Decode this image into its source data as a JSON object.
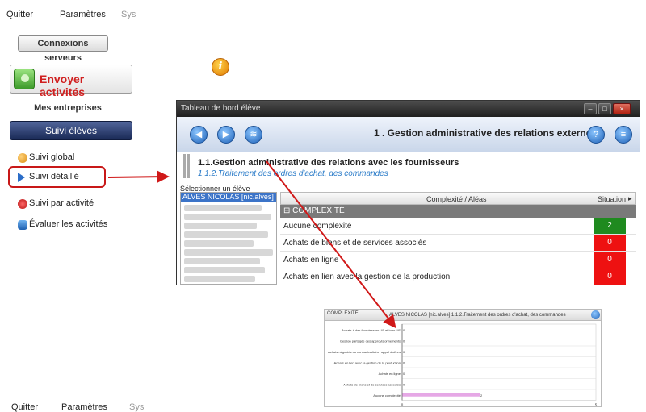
{
  "menubar": {
    "quit": "Quitter",
    "settings": "Paramètres",
    "sys": "Sys"
  },
  "left_panel": {
    "connexions_button": "Connexions serveurs",
    "send_button": "Envoyer activités",
    "companies_label": "Mes entreprises",
    "suivi_header": "Suivi élèves",
    "items": [
      {
        "label": "Suivi global",
        "icon": "users-icon"
      },
      {
        "label": "Suivi détaillé",
        "icon": "play-triangle-icon"
      },
      {
        "label": "Suivi par activité",
        "icon": "activity-icon"
      },
      {
        "label": "Évaluer les activités",
        "icon": "evaluate-icon"
      }
    ]
  },
  "info_icon_label": "i",
  "window": {
    "title": "Tableau de bord élève",
    "controls": [
      "–",
      "□",
      "×"
    ],
    "heading": "1 . Gestion administrative des relations externes",
    "breadcrumb_main": "1.1.Gestion administrative des relations avec les fournisseurs",
    "breadcrumb_sub": "1.1.2.Traitement des ordres d'achat, des commandes",
    "select_label": "Sélectionner un élève",
    "selected_student": "ALVES NICOLAS [nic.alves]",
    "grid": {
      "col_main": "Complexité / Aléas",
      "col_status": "Situation",
      "scroll_glyph": "▸",
      "group_label": "COMPLEXITÉ",
      "rows": [
        {
          "label": "Aucune complexité",
          "value": "2",
          "color": "#1f8a1f"
        },
        {
          "label": "Achats de biens et de services associés",
          "value": "0",
          "color": "#ee1111"
        },
        {
          "label": "Achats en ligne",
          "value": "0",
          "color": "#ee1111"
        },
        {
          "label": "Achats en lien avec la gestion de la production",
          "value": "0",
          "color": "#ee1111"
        }
      ]
    }
  },
  "chart_window": {
    "corner_label": "COMPLEXITÉ",
    "title": "ALVES NICOLAS [nic.alves] 1.1.2.Traitement des ordres d'achat, des commandes"
  },
  "chart_data": {
    "type": "bar",
    "orientation": "horizontal",
    "categories": [
      "Achats à des fournisseurs UE et hors UE",
      "Gestion partagée des approvisionnements",
      "Achats négociés ou contractualisés : appel d'offres",
      "Achats en lien avec la gestion de la production",
      "Achats en ligne",
      "Achats de biens et de services associés",
      "Aucune complexité"
    ],
    "values": [
      0,
      0,
      0,
      0,
      0,
      0,
      2
    ],
    "xlim": [
      0,
      5
    ],
    "x_ticks": [
      "0",
      "5"
    ],
    "bar_color": "#e6a8e6"
  },
  "bottom_menubar": {
    "quit": "Quitter",
    "settings": "Paramètres",
    "sys": "Sys"
  },
  "colors": {
    "accent_red": "#d02020",
    "header_navy": "#1a2a56",
    "link_blue": "#2a7bc8"
  }
}
